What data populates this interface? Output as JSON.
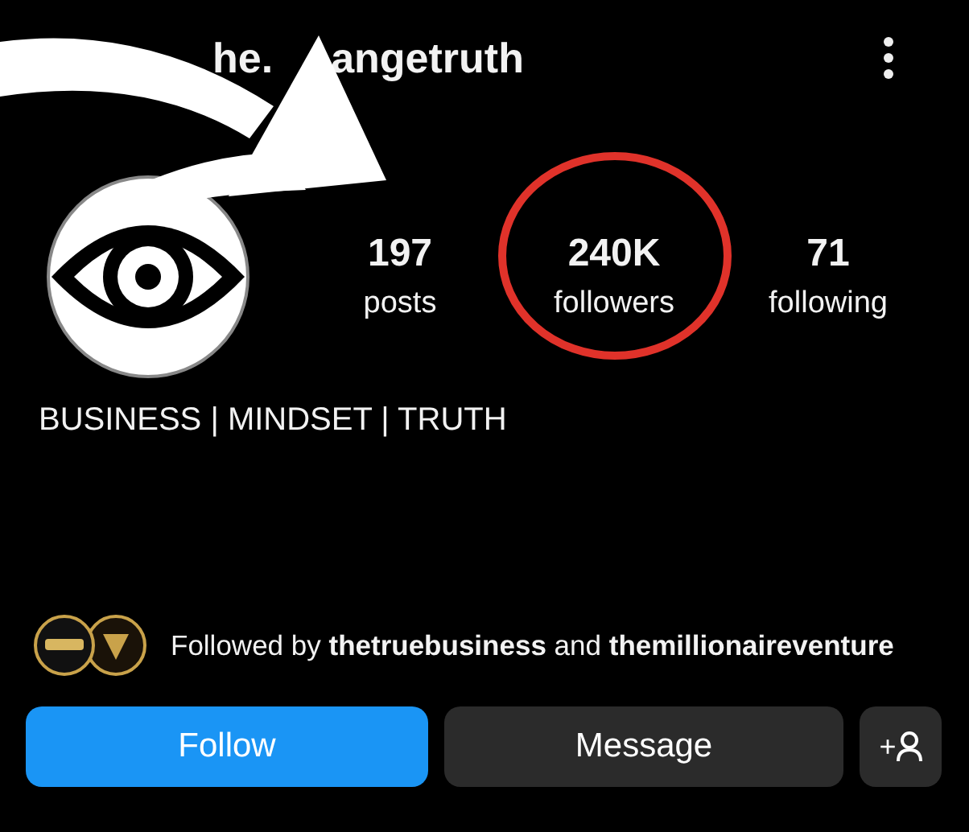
{
  "header": {
    "title_parts": [
      "he.",
      "angetruth"
    ]
  },
  "stats": [
    {
      "value": "197",
      "label": "posts",
      "circled": false
    },
    {
      "value": "240K",
      "label": "followers",
      "circled": true
    },
    {
      "value": "71",
      "label": "following",
      "circled": false
    }
  ],
  "bio": "BUSINESS | MINDSET | TRUTH",
  "followed_by": "Followed by **thetruebusiness** and **themillionaireventure**",
  "buttons": [
    {
      "label": "Follow",
      "kind": "primary"
    },
    {
      "label": "Message",
      "kind": "secondary"
    },
    {
      "label": "+",
      "kind": "icon"
    }
  ]
}
